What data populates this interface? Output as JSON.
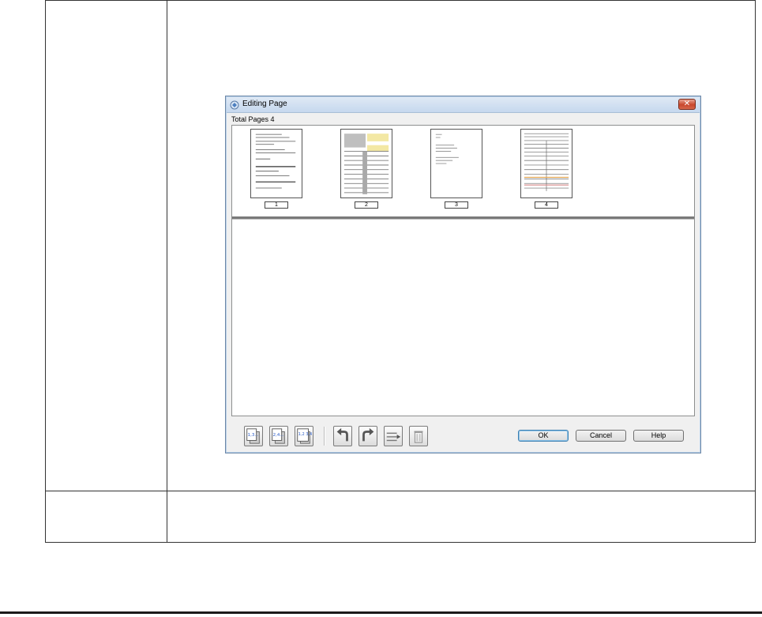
{
  "dialog": {
    "title": "Editing Page",
    "total_pages_label": "Total Pages 4",
    "close_label": "✕",
    "pages": [
      {
        "number": "1"
      },
      {
        "number": "2"
      },
      {
        "number": "3"
      },
      {
        "number": "4"
      }
    ],
    "toolbar": {
      "odd_pages_label": "1,3...",
      "even_pages_label": "2,4...",
      "all_pages_label": "1,2 3,4"
    },
    "buttons": {
      "ok": "OK",
      "cancel": "Cancel",
      "help": "Help"
    }
  },
  "colors": {
    "accent": "#3c7fb1",
    "close_red": "#c9462c",
    "icon_blue": "#2a5cc8"
  }
}
